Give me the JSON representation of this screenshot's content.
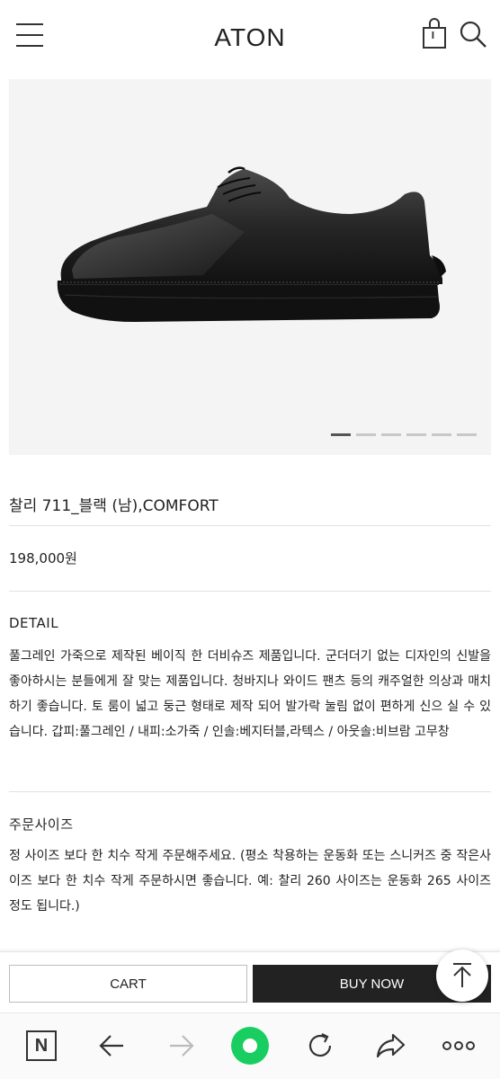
{
  "header": {
    "logo": "ATON",
    "menu_icon": "hamburger-menu-icon",
    "cart_icon": "shopping-bag-icon",
    "search_icon": "search-icon"
  },
  "gallery": {
    "image_subject": "black leather derby shoe",
    "total_slides": 6,
    "active_slide": 1
  },
  "product": {
    "title": "찰리 711_블랙 (남),COMFORT",
    "price": "198,000원"
  },
  "detail": {
    "label": "DETAIL",
    "text": "풀그레인 가죽으로 제작된 베이직 한 더비슈즈 제품입니다. 군더더기 없는 디자인의 신발을 좋아하시는 분들에게 잘 맞는 제품입니다. 청바지나 와이드 팬츠 등의 캐주얼한 의상과 매치하기 좋습니다. 토 룸이 넓고 둥근 형태로 제작 되어 발가락 눌림 없이 편하게 신으 실 수 있습니다. 갑피:풀그레인 / 내피:소가죽 / 인솔:베지터블,라텍스 / 아웃솔:비브람 고무창"
  },
  "size_info": {
    "label": "주문사이즈",
    "text": "정 사이즈 보다 한 치수 작게 주문해주세요. (평소 착용하는 운동화 또는 스니커즈 중 작은사이즈 보다 한 치수 작게 주문하시면 좋습니다. 예: 찰리 260 사이즈는 운동화 265 사이즈 정도 됩니다.)"
  },
  "actions": {
    "cart_label": "CART",
    "buy_label": "BUY NOW",
    "scroll_top_icon": "arrow-up-to-top-icon"
  },
  "browser_nav": {
    "icons": [
      "naver-n-icon",
      "back-arrow-icon",
      "forward-arrow-icon",
      "green-circle-icon",
      "refresh-icon",
      "share-icon",
      "more-dots-icon"
    ],
    "naver_glyph": "N"
  },
  "colors": {
    "text": "#222222",
    "buy_button": "#222222",
    "divider": "#e3e3e3",
    "hero_bg": "#f4f4f4",
    "green_accent": "#19ce60"
  }
}
